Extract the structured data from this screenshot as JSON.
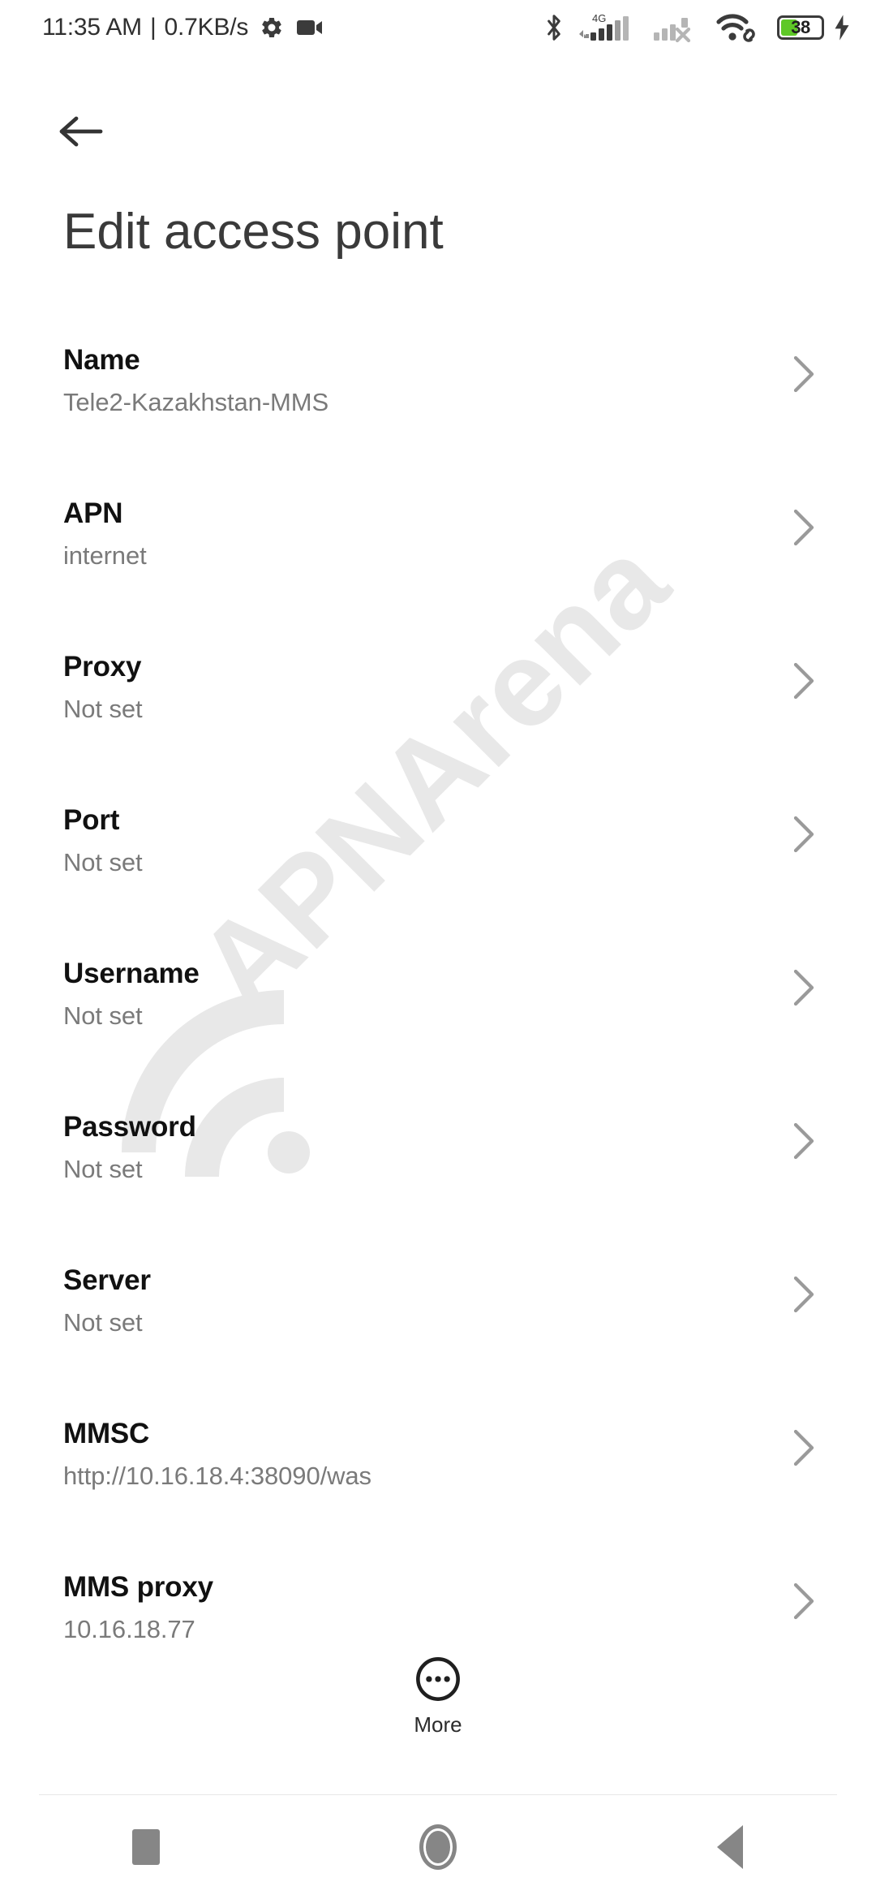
{
  "status_bar": {
    "time": "11:35 AM",
    "separator": "|",
    "network_speed": "0.7KB/s",
    "icons": {
      "gear": "gear-icon",
      "camera": "video-camera-icon",
      "bluetooth": "bluetooth-icon",
      "signal_sim1": "signal-4g-icon",
      "signal_sim1_label": "4G",
      "signal_sim2": "signal-no-service-icon",
      "wifi": "wifi-icon",
      "wifi_link": "link-icon",
      "battery": "battery-icon",
      "charging": "charging-bolt-icon"
    },
    "battery_percent": "38",
    "battery_color": "#5ec827"
  },
  "app_bar": {
    "back_icon": "arrow-left-icon",
    "title": "Edit access point"
  },
  "watermark": {
    "text": "APNArena",
    "color": "#e8e8e8"
  },
  "settings_list": [
    {
      "title": "Name",
      "value": "Tele2-Kazakhstan-MMS"
    },
    {
      "title": "APN",
      "value": "internet"
    },
    {
      "title": "Proxy",
      "value": "Not set"
    },
    {
      "title": "Port",
      "value": "Not set"
    },
    {
      "title": "Username",
      "value": "Not set"
    },
    {
      "title": "Password",
      "value": "Not set"
    },
    {
      "title": "Server",
      "value": "Not set"
    },
    {
      "title": "MMSC",
      "value": "http://10.16.18.4:38090/was"
    },
    {
      "title": "MMS proxy",
      "value": "10.16.18.77"
    }
  ],
  "more_button": {
    "label": "More",
    "icon": "more-horizontal-circle-icon"
  },
  "nav_bar": {
    "recents_label": "Recents",
    "home_label": "Home",
    "back_label": "Back",
    "color": "#868686"
  }
}
